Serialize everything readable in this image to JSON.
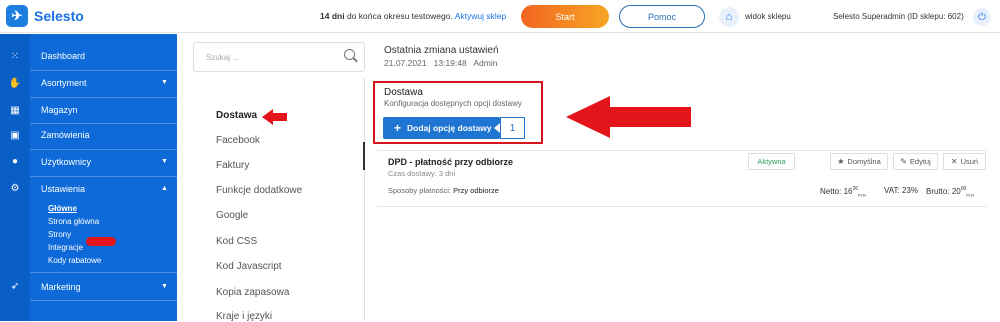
{
  "header": {
    "brand": "Selesto",
    "trial_days": "14 dni",
    "trial_text": "do końca okresu testowego.",
    "trial_link": "Aktywuj sklep",
    "start_label": "Start",
    "help_label": "Pomoc",
    "view_shop": "widok sklepu",
    "user": "Selesto Superadmin (ID sklepu: 602)"
  },
  "sidebar": {
    "items": [
      {
        "label": "Dashboard"
      },
      {
        "label": "Asortyment"
      },
      {
        "label": "Magazyn"
      },
      {
        "label": "Zamówienia"
      },
      {
        "label": "Użytkownicy"
      },
      {
        "label": "Ustawienia"
      },
      {
        "label": "Marketing"
      }
    ],
    "subitems": [
      {
        "label": "Główne"
      },
      {
        "label": "Strona główna"
      },
      {
        "label": "Strony"
      },
      {
        "label": "Integracje"
      },
      {
        "label": "Kody rabatowe"
      }
    ]
  },
  "settings_menu": {
    "search_placeholder": "Szukaj ...",
    "items": [
      {
        "label": "Dostawa"
      },
      {
        "label": "Facebook"
      },
      {
        "label": "Faktury"
      },
      {
        "label": "Funkcje dodatkowe"
      },
      {
        "label": "Google"
      },
      {
        "label": "Kod CSS"
      },
      {
        "label": "Kod Javascript"
      },
      {
        "label": "Kopia zapasowa"
      },
      {
        "label": "Kraje i języki"
      }
    ]
  },
  "main": {
    "last_change_label": "Ostatnia zmiana ustawień",
    "last_change_date": "21.07.2021",
    "last_change_time": "13:19:48",
    "last_change_user": "Admin",
    "section_title": "Dostawa",
    "section_desc": "Konfiguracja dostępnych opcji dostawy",
    "add_button": "Dodaj opcję dostawy",
    "count_badge": "1",
    "option": {
      "name": "DPD - płatność przy odbiorze",
      "time": "Czas dostawy: 3 dni",
      "payments_label": "Sposoby płatności:",
      "payments_value": "Przy odbiorze",
      "status": "Aktywna",
      "default_label": "Domyślna",
      "edit_label": "Edytuj",
      "delete_label": "Usuń",
      "netto_label": "Netto:",
      "netto_int": "16",
      "netto_dec": "26",
      "netto_cur": "PLN",
      "vat_label": "VAT:",
      "vat_value": "23%",
      "brutto_label": "Brutto:",
      "brutto_int": "20",
      "brutto_dec": "00",
      "brutto_cur": "PLN"
    }
  },
  "colors": {
    "sidebar": "#0d6ad8",
    "accent": "#1f76d2",
    "start_gradient_from": "#f26522",
    "start_gradient_to": "#f6a623",
    "highlight_red": "#d4151c",
    "status_green": "#2e9e52"
  },
  "icons": [
    "logo-icon",
    "home-icon",
    "power-icon",
    "grid-icon",
    "handshake-icon",
    "warehouse-icon",
    "bag-icon",
    "user-icon",
    "gear-icon",
    "rocket-icon",
    "search-icon",
    "plus-icon",
    "star-icon",
    "pencil-icon",
    "close-icon",
    "chevron-down-icon",
    "chevron-up-icon"
  ]
}
